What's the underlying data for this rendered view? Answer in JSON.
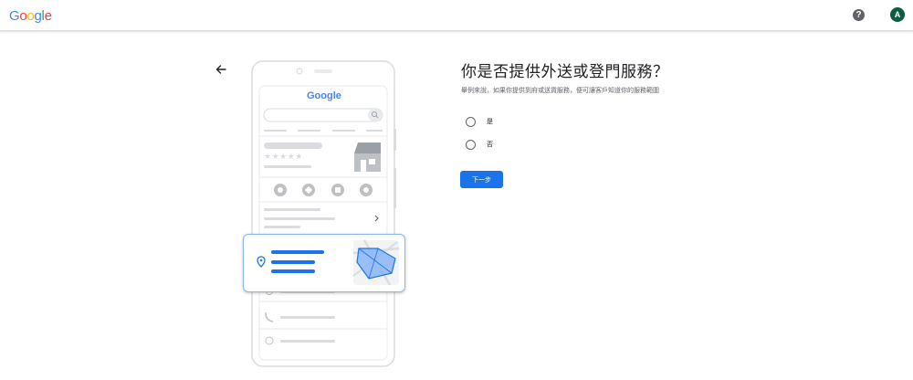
{
  "header": {
    "logo_letters": [
      "G",
      "o",
      "o",
      "g",
      "l",
      "e"
    ],
    "logo_colors": [
      "#4285F4",
      "#EA4335",
      "#FBBC05",
      "#4285F4",
      "#34A853",
      "#EA4335"
    ],
    "help_glyph": "?",
    "avatar_letter": "A",
    "avatar_color": "#0b5e42"
  },
  "illustration": {
    "phone_logo": "Google",
    "stars": "★★★★★"
  },
  "main": {
    "title": "你是否提供外送或登門服務？",
    "description": "舉例來說，如果你提供到府或送貨服務，便可讓客戶知道你的服務範圍",
    "options": [
      {
        "label": "是",
        "selected": false
      },
      {
        "label": "否",
        "selected": false
      }
    ],
    "next_label": "下一步",
    "accent_color": "#1a73e8"
  }
}
